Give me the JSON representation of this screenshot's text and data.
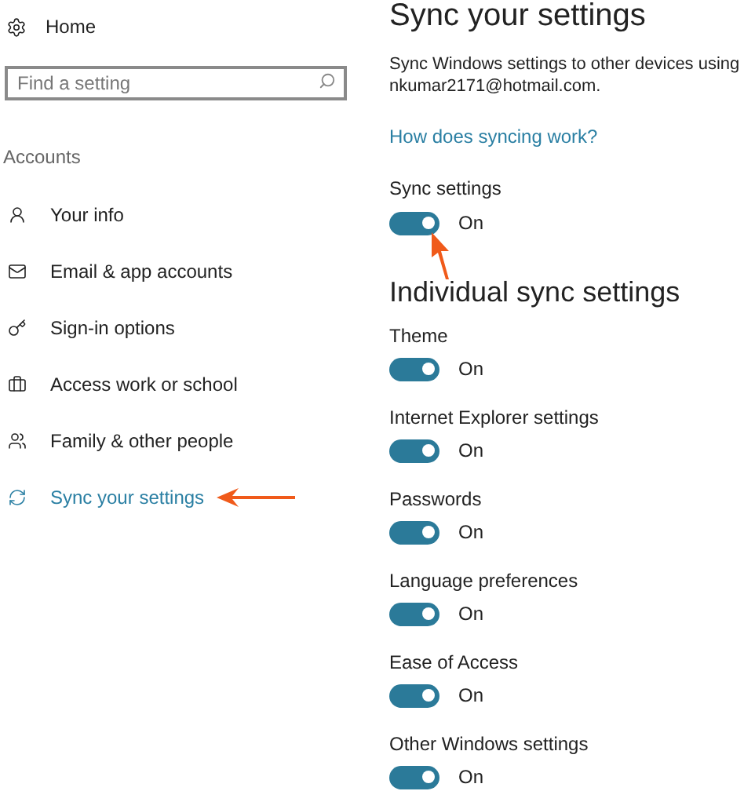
{
  "sidebar": {
    "home": "Home",
    "search": {
      "placeholder": "Find a setting"
    },
    "section": "Accounts",
    "items": [
      {
        "kind": "info",
        "label": "Your info",
        "selected": false
      },
      {
        "kind": "email",
        "label": "Email & app accounts",
        "selected": false
      },
      {
        "kind": "signin",
        "label": "Sign-in options",
        "selected": false
      },
      {
        "kind": "work",
        "label": "Access work or school",
        "selected": false
      },
      {
        "kind": "family",
        "label": "Family & other people",
        "selected": false
      },
      {
        "kind": "sync",
        "label": "Sync your settings",
        "selected": true
      }
    ]
  },
  "main": {
    "title": "Sync your settings",
    "description": "Sync Windows settings to other devices using nkumar2171@hotmail.com.",
    "link": "How does syncing work?",
    "sync": {
      "label": "Sync settings",
      "on": true,
      "state": "On"
    },
    "subtitle": "Individual sync settings",
    "settings": [
      {
        "label": "Theme",
        "on": true,
        "state": "On"
      },
      {
        "label": "Internet Explorer settings",
        "on": true,
        "state": "On"
      },
      {
        "label": "Passwords",
        "on": true,
        "state": "On"
      },
      {
        "label": "Language preferences",
        "on": true,
        "state": "On"
      },
      {
        "label": "Ease of Access",
        "on": true,
        "state": "On"
      },
      {
        "label": "Other Windows settings",
        "on": true,
        "state": "On"
      }
    ]
  }
}
